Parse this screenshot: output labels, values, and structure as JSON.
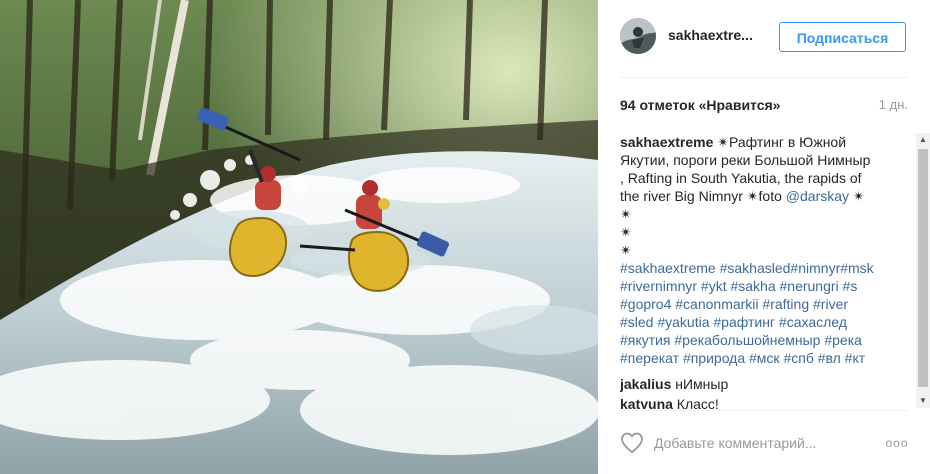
{
  "post": {
    "photo_icon": "rafting-photo",
    "header": {
      "avatar_icon": "profile-avatar",
      "username": "sakhaextre...",
      "follow_label": "Подписаться"
    },
    "likes_text": "94 отметок «Нравится»",
    "time_text": "1 дн.",
    "caption": {
      "author": "sakhaextreme",
      "lines": [
        " ✴Рафтинг в Южной",
        "Якутии, пороги реки Большой Нимныр",
        ", Rafting in South Yakutia, the rapids of",
        "the river Big Nimnyr ✴foto "
      ],
      "mention": "@darskay",
      "after_mention": " ✴",
      "stars": [
        "✴",
        "✴",
        "✴"
      ],
      "hashtag_lines": [
        "#sakhaextreme #sakhasled#nimnyr#msk",
        "#rivernimnyr #ykt #sakha #nerungri #s",
        "#gopro4 #canonmarkii #rafting #river",
        "#sled #yakutia #рафтинг #сахаслед",
        "#якутия #рекабольшойнемныр #река",
        "#перекат #природа #мск #спб #вл #кт"
      ]
    },
    "comments": [
      {
        "author": "jakalius",
        "text": " нИмныр"
      },
      {
        "author": "katyuna",
        "text": " Класс!"
      }
    ],
    "comment_placeholder": "Добавьте комментарий...",
    "more_label": "ооо",
    "icons": {
      "heart": "heart-icon",
      "more": "more-options-icon",
      "scroll_up": "scroll-up-arrow-icon",
      "scroll_down": "scroll-down-arrow-icon"
    },
    "colors": {
      "accent": "#3897f0",
      "link": "#3c6a9b",
      "text": "#262626",
      "muted": "#999999"
    }
  }
}
